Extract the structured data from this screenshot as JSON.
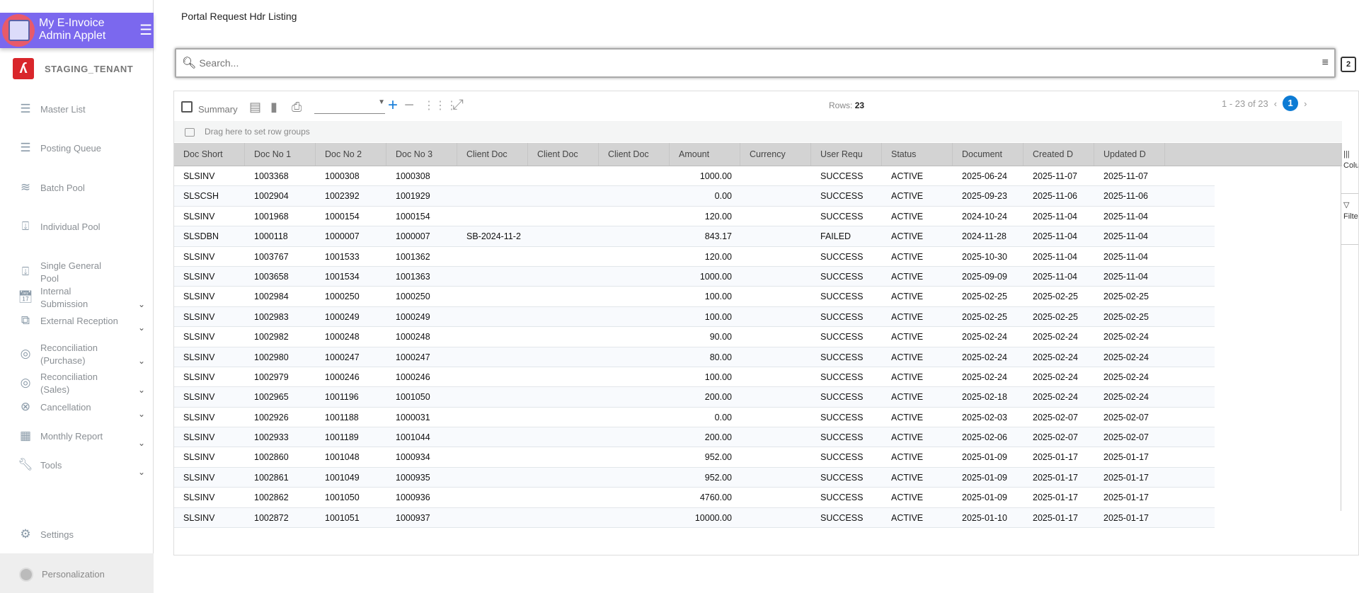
{
  "app": {
    "title_line1": "My E-Invoice",
    "title_line2": "Admin Applet",
    "tenant": "STAGING_TENANT"
  },
  "sidebar": {
    "items": [
      {
        "label": "Master List",
        "icon": "list-icon",
        "expandable": false
      },
      {
        "label": "Posting Queue",
        "icon": "list-icon",
        "expandable": false
      },
      {
        "label": "Batch Pool",
        "icon": "waves-icon",
        "expandable": false
      },
      {
        "label": "Individual Pool",
        "icon": "inbox-download-icon",
        "expandable": false
      },
      {
        "label": "Single General Pool",
        "icon": "inbox-download-icon",
        "expandable": false
      },
      {
        "label": "Internal Submission",
        "icon": "calendar-refresh-icon",
        "expandable": true
      },
      {
        "label": "External Reception",
        "icon": "external-link-icon",
        "expandable": true
      },
      {
        "label": "Reconciliation (Purchase)",
        "icon": "overlap-circles-icon",
        "expandable": true
      },
      {
        "label": "Reconciliation (Sales)",
        "icon": "overlap-circles-icon",
        "expandable": true
      },
      {
        "label": "Cancellation",
        "icon": "cancel-circle-icon",
        "expandable": true
      },
      {
        "label": "Monthly Report",
        "icon": "calendar-icon",
        "expandable": true
      },
      {
        "label": "Tools",
        "icon": "wrench-icon",
        "expandable": true
      }
    ],
    "settings": "Settings",
    "personalization": "Personalization"
  },
  "page": {
    "title": "Portal Request Hdr Listing"
  },
  "search": {
    "placeholder": "Search...",
    "value": ""
  },
  "toolbar": {
    "summary_label": "Summary",
    "rows_label": "Rows:",
    "rows_count": "23",
    "pagination": "1 - 23 of 23",
    "current_page": "1"
  },
  "grid": {
    "group_hint": "Drag here to set row groups",
    "columns": [
      "Doc Short",
      "Doc No 1",
      "Doc No 2",
      "Doc No 3",
      "Client Doc",
      "Client Doc",
      "Client Doc",
      "Amount",
      "Currency",
      "User Requ",
      "Status",
      "Document",
      "Created D",
      "Updated D"
    ],
    "rows": [
      [
        "SLSINV",
        "1003368",
        "1000308",
        "1000308",
        "",
        "",
        "",
        "1000.00",
        "",
        "SUCCESS",
        "ACTIVE",
        "2025-06-24",
        "2025-11-07",
        "2025-11-07"
      ],
      [
        "SLSCSH",
        "1002904",
        "1002392",
        "1001929",
        "",
        "",
        "",
        "0.00",
        "",
        "SUCCESS",
        "ACTIVE",
        "2025-09-23",
        "2025-11-06",
        "2025-11-06"
      ],
      [
        "SLSINV",
        "1001968",
        "1000154",
        "1000154",
        "",
        "",
        "",
        "120.00",
        "",
        "SUCCESS",
        "ACTIVE",
        "2024-10-24",
        "2025-11-04",
        "2025-11-04"
      ],
      [
        "SLSDBN",
        "1000118",
        "1000007",
        "1000007",
        "SB-2024-11-2",
        "",
        "",
        "843.17",
        "",
        "FAILED",
        "ACTIVE",
        "2024-11-28",
        "2025-11-04",
        "2025-11-04"
      ],
      [
        "SLSINV",
        "1003767",
        "1001533",
        "1001362",
        "",
        "",
        "",
        "120.00",
        "",
        "SUCCESS",
        "ACTIVE",
        "2025-10-30",
        "2025-11-04",
        "2025-11-04"
      ],
      [
        "SLSINV",
        "1003658",
        "1001534",
        "1001363",
        "",
        "",
        "",
        "1000.00",
        "",
        "SUCCESS",
        "ACTIVE",
        "2025-09-09",
        "2025-11-04",
        "2025-11-04"
      ],
      [
        "SLSINV",
        "1002984",
        "1000250",
        "1000250",
        "",
        "",
        "",
        "100.00",
        "",
        "SUCCESS",
        "ACTIVE",
        "2025-02-25",
        "2025-02-25",
        "2025-02-25"
      ],
      [
        "SLSINV",
        "1002983",
        "1000249",
        "1000249",
        "",
        "",
        "",
        "100.00",
        "",
        "SUCCESS",
        "ACTIVE",
        "2025-02-25",
        "2025-02-25",
        "2025-02-25"
      ],
      [
        "SLSINV",
        "1002982",
        "1000248",
        "1000248",
        "",
        "",
        "",
        "90.00",
        "",
        "SUCCESS",
        "ACTIVE",
        "2025-02-24",
        "2025-02-24",
        "2025-02-24"
      ],
      [
        "SLSINV",
        "1002980",
        "1000247",
        "1000247",
        "",
        "",
        "",
        "80.00",
        "",
        "SUCCESS",
        "ACTIVE",
        "2025-02-24",
        "2025-02-24",
        "2025-02-24"
      ],
      [
        "SLSINV",
        "1002979",
        "1000246",
        "1000246",
        "",
        "",
        "",
        "100.00",
        "",
        "SUCCESS",
        "ACTIVE",
        "2025-02-24",
        "2025-02-24",
        "2025-02-24"
      ],
      [
        "SLSINV",
        "1002965",
        "1001196",
        "1001050",
        "",
        "",
        "",
        "200.00",
        "",
        "SUCCESS",
        "ACTIVE",
        "2025-02-18",
        "2025-02-24",
        "2025-02-24"
      ],
      [
        "SLSINV",
        "1002926",
        "1001188",
        "1000031",
        "",
        "",
        "",
        "0.00",
        "",
        "SUCCESS",
        "ACTIVE",
        "2025-02-03",
        "2025-02-07",
        "2025-02-07"
      ],
      [
        "SLSINV",
        "1002933",
        "1001189",
        "1001044",
        "",
        "",
        "",
        "200.00",
        "",
        "SUCCESS",
        "ACTIVE",
        "2025-02-06",
        "2025-02-07",
        "2025-02-07"
      ],
      [
        "SLSINV",
        "1002860",
        "1001048",
        "1000934",
        "",
        "",
        "",
        "952.00",
        "",
        "SUCCESS",
        "ACTIVE",
        "2025-01-09",
        "2025-01-17",
        "2025-01-17"
      ],
      [
        "SLSINV",
        "1002861",
        "1001049",
        "1000935",
        "",
        "",
        "",
        "952.00",
        "",
        "SUCCESS",
        "ACTIVE",
        "2025-01-09",
        "2025-01-17",
        "2025-01-17"
      ],
      [
        "SLSINV",
        "1002862",
        "1001050",
        "1000936",
        "",
        "",
        "",
        "4760.00",
        "",
        "SUCCESS",
        "ACTIVE",
        "2025-01-09",
        "2025-01-17",
        "2025-01-17"
      ],
      [
        "SLSINV",
        "1002872",
        "1001051",
        "1000937",
        "",
        "",
        "",
        "10000.00",
        "",
        "SUCCESS",
        "ACTIVE",
        "2025-01-10",
        "2025-01-17",
        "2025-01-17"
      ]
    ],
    "side_panel": [
      "Columns",
      "Filters"
    ]
  },
  "colors": {
    "brand": "#7b68ee",
    "accent": "#0d7bd4",
    "tenant_logo": "#d9262b"
  }
}
